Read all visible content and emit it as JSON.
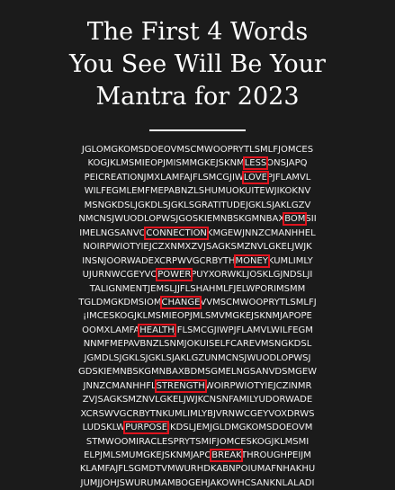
{
  "title_lines": [
    "The First 4 Words",
    "You See Will Be Your",
    "Mantra for 2023"
  ],
  "highlight_color": "#e0141e",
  "grid": [
    {
      "segments": [
        {
          "text": "JGLOMGKOMSDOEOVMSCMWOOPRYTLSMLFJOMCES"
        }
      ]
    },
    {
      "segments": [
        {
          "text": "KOGJKLMSMIEOPJMISMMGKEJSKNM"
        },
        {
          "text": "LESS",
          "hl": true
        },
        {
          "text": "ONSJAPQ"
        }
      ]
    },
    {
      "segments": [
        {
          "text": "PEICREATIONJMXLAMFAJFLSMCGJIW"
        },
        {
          "text": "LOVE",
          "hl": true
        },
        {
          "text": "PJFLAMVL"
        }
      ]
    },
    {
      "segments": [
        {
          "text": "WILFEGMLEMFMEPABNZLSHUMUOKUITEWJIKOKNV"
        }
      ]
    },
    {
      "segments": [
        {
          "text": "MSNGKDSLJGKDLSJGKLSGRATITUDEJGKLSJAKLGZV"
        }
      ]
    },
    {
      "segments": [
        {
          "text": "NMCNSJWUODLOPWSJGOSKIEMNBSKGMNBAX"
        },
        {
          "text": "BOM",
          "hl": true
        },
        {
          "text": "SII"
        }
      ]
    },
    {
      "segments": [
        {
          "text": "IMELNGSANVO"
        },
        {
          "text": "CONNECTION",
          "hl": true
        },
        {
          "text": "KMGEWJNNZCMANHHEL"
        }
      ]
    },
    {
      "segments": [
        {
          "text": "NOIRPWIOTYIEJCZXNMXZVJSAGKSMZNVLGKELJWJK"
        }
      ]
    },
    {
      "segments": [
        {
          "text": "INSNJOORWADEXCRPWVGCRBYTH"
        },
        {
          "text": "MONEY",
          "hl": true
        },
        {
          "text": "KUMLIMLY"
        }
      ]
    },
    {
      "segments": [
        {
          "text": "UJURNWCGEYVO"
        },
        {
          "text": "POWER",
          "hl": true
        },
        {
          "text": "PUYXORWKLJOSKLGJNDSLJI"
        }
      ]
    },
    {
      "segments": [
        {
          "text": "TALIGNMENTJEMSLJJFLSHAHMLFJELWPORIMSMM"
        }
      ]
    },
    {
      "segments": [
        {
          "text": "TGLDMGKDMSIOM"
        },
        {
          "text": "CHANGE",
          "hl": true
        },
        {
          "text": "VVMSCMWOOPRYTLSMLFJ"
        }
      ]
    },
    {
      "segments": [
        {
          "text": "¡IMCESKOGJKLMSMIEOPJMLSMVMGKEJSKNMJAPOPE"
        }
      ]
    },
    {
      "segments": [
        {
          "text": "OOMXLAMFA"
        },
        {
          "text": "HEALTH",
          "hl": true
        },
        {
          "text": "JFLSMCGJIWPJFLAMVLWILFEGM"
        }
      ]
    },
    {
      "segments": [
        {
          "text": "NNMFMEPAVBNZLSNMJOKUISELFCAREVMSNGKDSL"
        }
      ]
    },
    {
      "segments": [
        {
          "text": "JGMDLSJGKLSJGKLSJAKLGZUNMCNSJWUODLOPWSJ"
        }
      ]
    },
    {
      "segments": [
        {
          "text": "GDSKIEMNBSKGMNBAXBDMSGMELNGSANVDSMGEW"
        }
      ]
    },
    {
      "segments": [
        {
          "text": "JNNZCMANHHFL"
        },
        {
          "text": "STRENGTH",
          "hl": true
        },
        {
          "text": "WOIRPWIOTYIEJCZINMR"
        }
      ]
    },
    {
      "segments": [
        {
          "text": "ZVJSAGKSMZNVLGKELJWJKCNSNFAMILYUDORWADE"
        }
      ]
    },
    {
      "segments": [
        {
          "text": "XCRSWVGCRBYTNKUMLIMLYBJVRNWCGEYVOXDRWS"
        }
      ]
    },
    {
      "segments": [
        {
          "text": "LUDSKLW"
        },
        {
          "text": "PURPOSE",
          "hl": true
        },
        {
          "text": "JKDSLJEMJGLDMGKOMSDOEOVM"
        }
      ]
    },
    {
      "segments": [
        {
          "text": "STMWOOMIRACLESPRYTSMIFJOMCESKOGJKLMSMI"
        }
      ]
    },
    {
      "segments": [
        {
          "text": "ELPJMLSMUMGKEJSKNMJAPO"
        },
        {
          "text": "BREAK",
          "hl": true
        },
        {
          "text": "THROUGHPEIJM"
        }
      ]
    },
    {
      "segments": [
        {
          "text": "KLAMFAJFLSGMDTVMWURHDKABNPOIUMAFNHAKHU"
        }
      ]
    },
    {
      "segments": [
        {
          "text": "JUMJJOHJSWURUMAMBOGEHJAKOWHCSANKNLALADI"
        }
      ]
    }
  ]
}
